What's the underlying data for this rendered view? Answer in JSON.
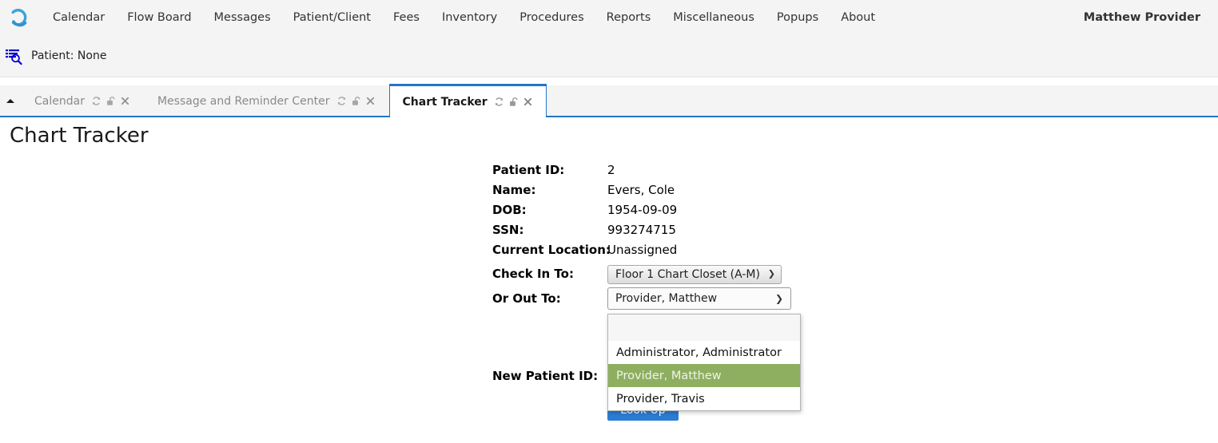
{
  "navbar": {
    "logo_icon": "loop-logo-icon",
    "items": [
      {
        "label": "Calendar"
      },
      {
        "label": "Flow Board"
      },
      {
        "label": "Messages"
      },
      {
        "label": "Patient/Client"
      },
      {
        "label": "Fees"
      },
      {
        "label": "Inventory"
      },
      {
        "label": "Procedures"
      },
      {
        "label": "Reports"
      },
      {
        "label": "Miscellaneous"
      },
      {
        "label": "Popups"
      },
      {
        "label": "About"
      }
    ],
    "user": "Matthew Provider"
  },
  "patient_bar": {
    "icon": "patient-search-icon",
    "text": "Patient: None"
  },
  "tabbar": {
    "collapse_icon": "caret-up-icon",
    "tabs": [
      {
        "label": "Calendar",
        "active": false
      },
      {
        "label": "Message and Reminder Center",
        "active": false
      },
      {
        "label": "Chart Tracker",
        "active": true
      }
    ],
    "tab_icon_names": [
      "refresh-icon",
      "unlock-icon",
      "close-icon"
    ]
  },
  "page": {
    "title": "Chart Tracker"
  },
  "form": {
    "fields": [
      {
        "label": "Patient ID:",
        "value": "2"
      },
      {
        "label": "Name:",
        "value": "Evers, Cole"
      },
      {
        "label": "DOB:",
        "value": "1954-09-09"
      },
      {
        "label": "SSN:",
        "value": "993274715"
      },
      {
        "label": "Current Location:",
        "value": "Unassigned"
      }
    ],
    "check_in_label": "Check In To:",
    "check_in_value": "Floor 1 Chart Closet (A-M)",
    "or_out_label": "Or Out To:",
    "or_out_value": "Provider, Matthew",
    "new_patient_id_label": "New Patient ID:",
    "lookup_label": "Look Up"
  },
  "dropdown": {
    "open": true,
    "blank_option": "",
    "options": [
      {
        "label": "Administrator, Administrator",
        "selected": false
      },
      {
        "label": "Provider, Matthew",
        "selected": true
      },
      {
        "label": "Provider, Travis",
        "selected": false
      }
    ],
    "highlight_color": "#8eaf60"
  },
  "colors": {
    "accent_blue": "#2176c7",
    "button_blue": "#2b7cd3",
    "chrome_gray": "#f4f4f4",
    "logo_blue": "#3aa3dd"
  }
}
